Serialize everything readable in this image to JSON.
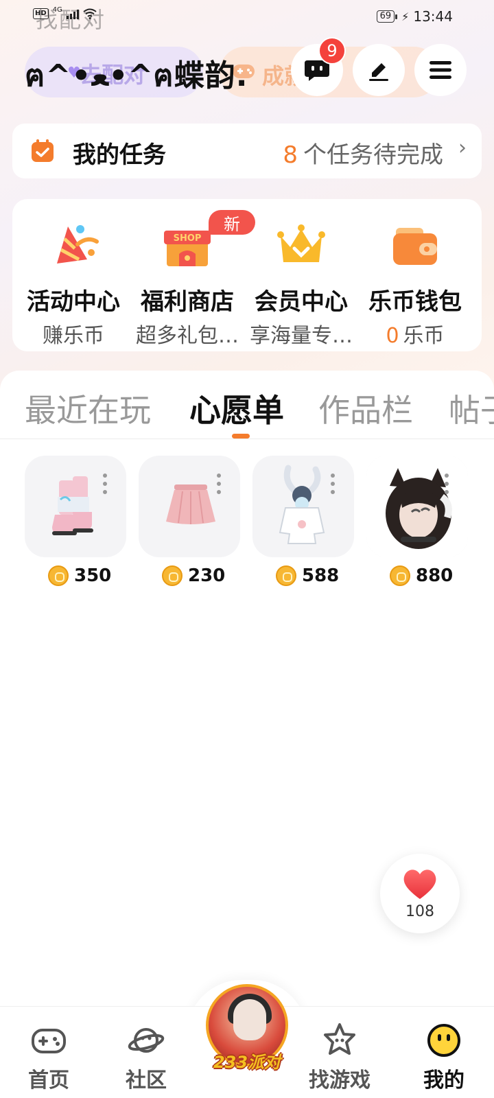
{
  "status_bar": {
    "hd": "HD",
    "network": "4G",
    "ghost_text": "找配对",
    "battery": "69",
    "time": "13:44"
  },
  "header": {
    "username": "ฅ^•ﻌ•^ฅ蝶韵.",
    "tag_left": "去配对",
    "tag_right": "成就作",
    "message_badge": "9"
  },
  "tasks": {
    "title": "我的任务",
    "count": "8",
    "suffix": "个任务待完成"
  },
  "entries": [
    {
      "label": "活动中心",
      "sub": "赚乐币",
      "icon": "party-hat-icon"
    },
    {
      "label": "福利商店",
      "sub": "超多礼包…",
      "icon": "shop-icon",
      "tag": "新"
    },
    {
      "label": "会员中心",
      "sub": "享海量专…",
      "icon": "crown-icon"
    },
    {
      "label": "乐币钱包",
      "sub_number": "0",
      "sub": "乐币",
      "icon": "wallet-icon"
    }
  ],
  "tabs": [
    {
      "label": "最近在玩",
      "active": false
    },
    {
      "label": "心愿单",
      "active": true
    },
    {
      "label": "作品栏",
      "active": false
    },
    {
      "label": "帖子",
      "active": false
    }
  ],
  "wishlist": [
    {
      "price": "350",
      "item": "boots"
    },
    {
      "price": "230",
      "item": "skirt"
    },
    {
      "price": "588",
      "item": "bunny-hoodie"
    },
    {
      "price": "880",
      "item": "cat-ear-girl"
    }
  ],
  "like_fab": {
    "count": "108"
  },
  "bottom_nav": [
    {
      "label": "首页",
      "icon": "gamepad-icon",
      "active": false
    },
    {
      "label": "社区",
      "icon": "planet-icon",
      "active": false
    },
    {
      "label": "233派对",
      "icon": "party-avatar",
      "active": false
    },
    {
      "label": "找游戏",
      "icon": "star-face-icon",
      "active": false
    },
    {
      "label": "我的",
      "icon": "smiley-icon",
      "active": true
    }
  ],
  "colors": {
    "accent": "#f47c2c",
    "badge_red": "#f4423c",
    "heart_red": "#f04a4a"
  }
}
